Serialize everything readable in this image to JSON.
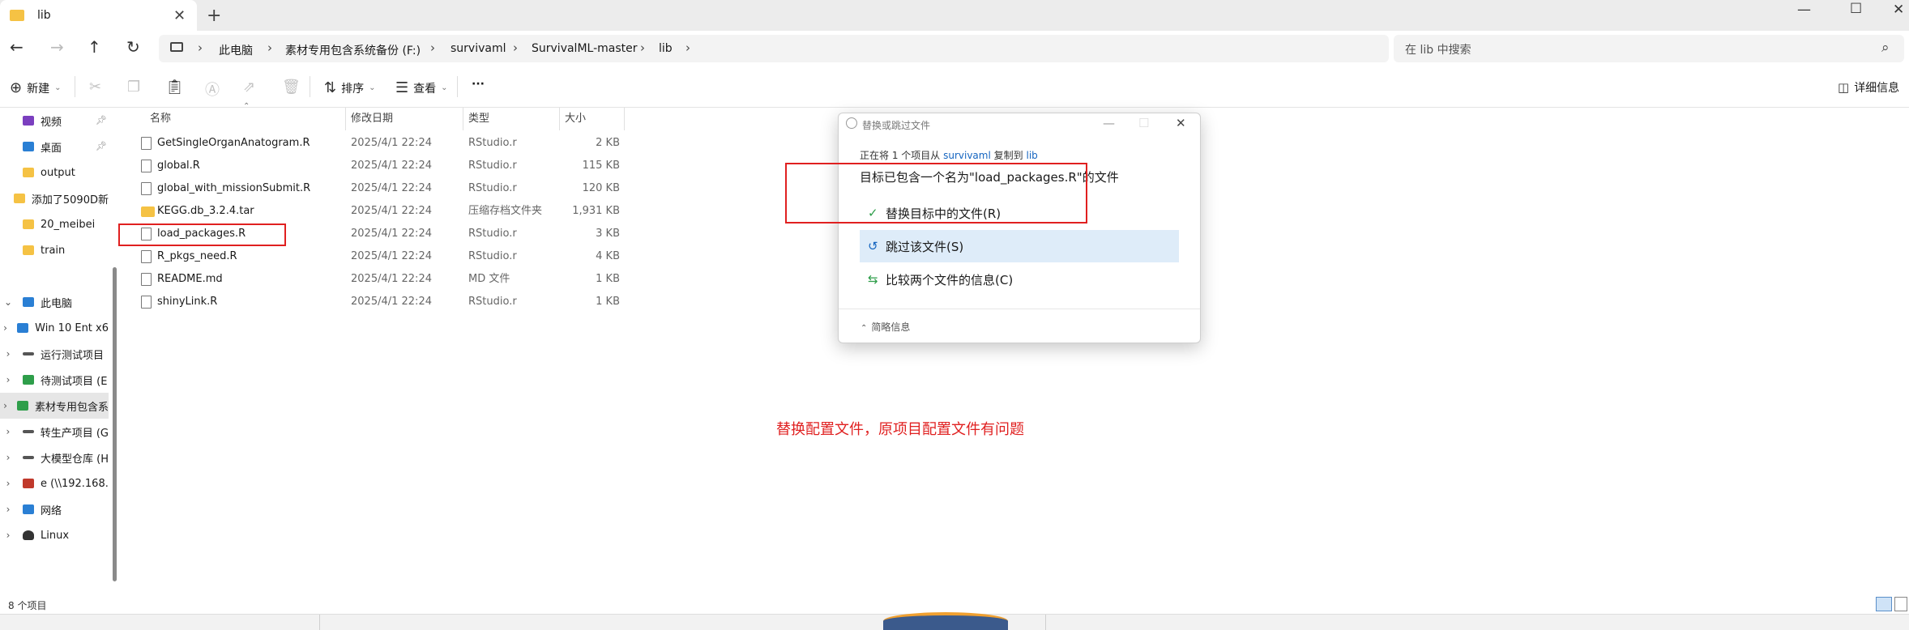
{
  "window": {
    "tab_title": "lib",
    "new_tab": "+",
    "min": "—",
    "max": "☐",
    "close": "✕"
  },
  "nav": {
    "breadcrumbs": [
      "此电脑",
      "素材专用包含系统备份 (F:)",
      "survivaml",
      "SurvivalML-master",
      "lib"
    ],
    "search_placeholder": "在 lib 中搜索"
  },
  "toolbar": {
    "new_label": "新建",
    "sort_label": "排序",
    "view_label": "查看",
    "more_label": "···",
    "details_label": "详细信息"
  },
  "sidebar": {
    "items": [
      {
        "label": "视频",
        "color": "#7b3fbf",
        "pinned": true
      },
      {
        "label": "桌面",
        "color": "#2a7fd4",
        "pinned": true
      },
      {
        "label": "output",
        "color": "#f5c244",
        "pinned": false
      },
      {
        "label": "添加了5090D新",
        "color": "#f5c244",
        "pinned": false
      },
      {
        "label": "20_meibei",
        "color": "#f5c244",
        "pinned": false
      },
      {
        "label": "train",
        "color": "#f5c244",
        "pinned": false
      },
      {
        "label": "此电脑",
        "color": "#2a7fd4",
        "expanded": true
      },
      {
        "label": "Win 10 Ent x6",
        "color": "#2a7fd4"
      },
      {
        "label": "运行测试项目",
        "color": "#555555"
      },
      {
        "label": "待测试项目 (E",
        "color": "#2e9e4a"
      },
      {
        "label": "素材专用包含系",
        "color": "#2e9e4a",
        "selected": true
      },
      {
        "label": "转生产项目 (G",
        "color": "#555555"
      },
      {
        "label": "大模型仓库 (H",
        "color": "#555555"
      },
      {
        "label": "e (\\\\192.168.",
        "color": "#c0392b"
      },
      {
        "label": "网络",
        "color": "#2a7fd4"
      },
      {
        "label": "Linux",
        "color": "#333333"
      }
    ]
  },
  "columns": [
    "名称",
    "修改日期",
    "类型",
    "大小"
  ],
  "files": [
    {
      "name": "GetSingleOrganAnatogram.R",
      "date": "2025/4/1 22:24",
      "type": "RStudio.r",
      "size": "2 KB",
      "kind": "file"
    },
    {
      "name": "global.R",
      "date": "2025/4/1 22:24",
      "type": "RStudio.r",
      "size": "115 KB",
      "kind": "file"
    },
    {
      "name": "global_with_missionSubmit.R",
      "date": "2025/4/1 22:24",
      "type": "RStudio.r",
      "size": "120 KB",
      "kind": "file"
    },
    {
      "name": "KEGG.db_3.2.4.tar",
      "date": "2025/4/1 22:24",
      "type": "压缩存档文件夹",
      "size": "1,931 KB",
      "kind": "archive"
    },
    {
      "name": "load_packages.R",
      "date": "2025/4/1 22:24",
      "type": "RStudio.r",
      "size": "3 KB",
      "kind": "file"
    },
    {
      "name": "R_pkgs_need.R",
      "date": "2025/4/1 22:24",
      "type": "RStudio.r",
      "size": "4 KB",
      "kind": "file"
    },
    {
      "name": "README.md",
      "date": "2025/4/1 22:24",
      "type": "MD 文件",
      "size": "1 KB",
      "kind": "file"
    },
    {
      "name": "shinyLink.R",
      "date": "2025/4/1 22:24",
      "type": "RStudio.r",
      "size": "1 KB",
      "kind": "file"
    }
  ],
  "dialog": {
    "title": "替换或跳过文件",
    "line1_prefix": "正在将 1 个项目从",
    "line1_src": "survivaml",
    "line1_mid": "复制到",
    "line1_dst": "lib",
    "message": "目标已包含一个名为\"load_packages.R\"的文件",
    "options": [
      "替换目标中的文件(R)",
      "跳过该文件(S)",
      "比较两个文件的信息(C)"
    ],
    "more_info": "简略信息"
  },
  "annotation": "替换配置文件，原项目配置文件有问题",
  "status": {
    "item_count": "8 个项目"
  },
  "colors": {
    "accent_red": "#e02020",
    "selection_blue": "#deecf9",
    "link_blue": "#1565c0"
  }
}
